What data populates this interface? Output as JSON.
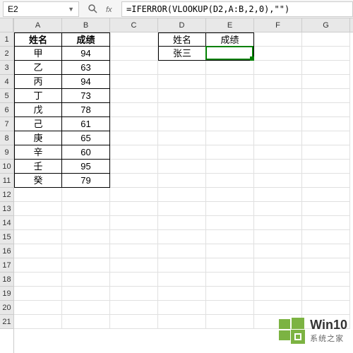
{
  "formula_bar": {
    "cell_ref": "E2",
    "formula": "=IFERROR(VLOOKUP(D2,A:B,2,0),\"\")"
  },
  "columns": [
    "A",
    "B",
    "C",
    "D",
    "E",
    "F",
    "G"
  ],
  "rows": [
    1,
    2,
    3,
    4,
    5,
    6,
    7,
    8,
    9,
    10,
    11,
    12,
    13,
    14,
    15,
    16,
    17,
    18,
    19,
    20,
    21
  ],
  "table1": {
    "headers": {
      "name": "姓名",
      "score": "成绩"
    },
    "data": [
      {
        "name": "甲",
        "score": "94"
      },
      {
        "name": "乙",
        "score": "63"
      },
      {
        "name": "丙",
        "score": "94"
      },
      {
        "name": "丁",
        "score": "73"
      },
      {
        "name": "戊",
        "score": "78"
      },
      {
        "name": "己",
        "score": "61"
      },
      {
        "name": "庚",
        "score": "65"
      },
      {
        "name": "辛",
        "score": "60"
      },
      {
        "name": "壬",
        "score": "95"
      },
      {
        "name": "癸",
        "score": "79"
      }
    ]
  },
  "table2": {
    "headers": {
      "name": "姓名",
      "score": "成绩"
    },
    "lookup_name": "张三",
    "lookup_result": ""
  },
  "watermark": {
    "line1": "Win10",
    "line2": "系统之家"
  },
  "active_cell": {
    "col": 4,
    "row": 1
  }
}
